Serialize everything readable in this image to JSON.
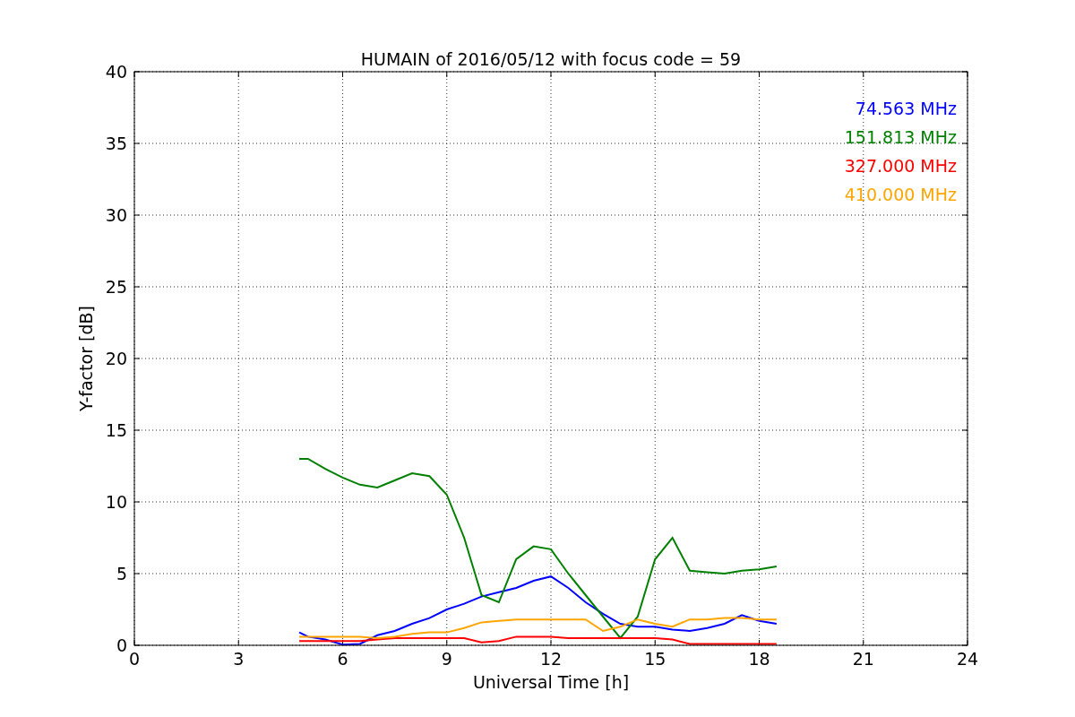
{
  "figure": {
    "chart_data": {
      "type": "line",
      "title": "HUMAIN of 2016/05/12 with focus code = 59",
      "xlabel": "Universal Time [h]",
      "ylabel": "Y-factor [dB]",
      "x": [
        4.75,
        5,
        5.5,
        6,
        6.5,
        7,
        7.5,
        8,
        8.5,
        9,
        9.5,
        10,
        10.5,
        11,
        11.5,
        12,
        12.5,
        13,
        13.5,
        14,
        14.5,
        15,
        15.5,
        16,
        16.5,
        17,
        17.5,
        18,
        18.5
      ],
      "series": [
        {
          "name": "74.563 MHz",
          "color": "#0000ff",
          "values": [
            0.9,
            0.6,
            0.4,
            0.05,
            0.1,
            0.7,
            1,
            1.5,
            1.9,
            2.5,
            2.9,
            3.4,
            3.7,
            4,
            4.5,
            4.8,
            4,
            3,
            2.2,
            1.5,
            1.3,
            1.3,
            1.1,
            1,
            1.2,
            1.5,
            2.1,
            1.7,
            1.5
          ]
        },
        {
          "name": "151.813 MHz",
          "color": "#008000",
          "values": [
            13,
            13,
            12.3,
            11.7,
            11.2,
            11,
            11.5,
            12,
            11.8,
            10.5,
            7.5,
            3.5,
            3,
            6,
            6.9,
            6.7,
            5,
            3.5,
            2,
            0.5,
            2,
            6,
            7.5,
            5.2,
            5.1,
            5,
            5.2,
            5.3,
            5.5
          ]
        },
        {
          "name": "327.000 MHz",
          "color": "#ff0000",
          "values": [
            0.3,
            0.3,
            0.3,
            0.3,
            0.3,
            0.4,
            0.5,
            0.5,
            0.5,
            0.5,
            0.5,
            0.2,
            0.3,
            0.6,
            0.6,
            0.6,
            0.5,
            0.5,
            0.5,
            0.5,
            0.5,
            0.5,
            0.4,
            0.1,
            0.1,
            0.1,
            0.1,
            0.1,
            0.1
          ]
        },
        {
          "name": "410.000 MHz",
          "color": "#ffa500",
          "values": [
            0.6,
            0.6,
            0.6,
            0.6,
            0.6,
            0.5,
            0.6,
            0.8,
            0.9,
            0.9,
            1.2,
            1.6,
            1.7,
            1.8,
            1.8,
            1.8,
            1.8,
            1.8,
            1,
            1.3,
            1.8,
            1.5,
            1.3,
            1.8,
            1.8,
            1.9,
            1.9,
            1.8,
            1.8
          ]
        }
      ],
      "grid": true,
      "xlim": [
        0,
        24
      ],
      "ylim": [
        0,
        40
      ],
      "xticks": [
        0,
        3,
        6,
        9,
        12,
        15,
        18,
        21,
        24
      ],
      "yticks": [
        0,
        5,
        10,
        15,
        20,
        25,
        30,
        35,
        40
      ]
    }
  }
}
